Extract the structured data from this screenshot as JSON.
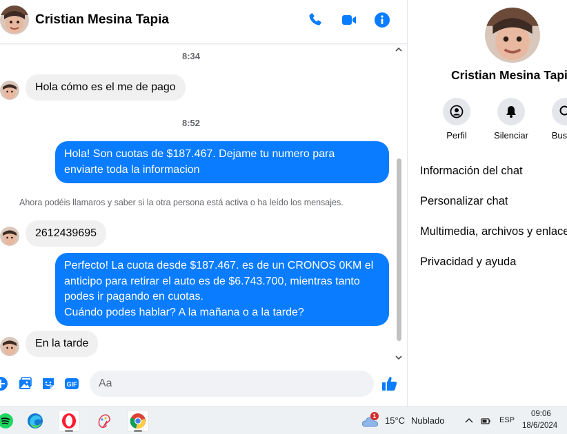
{
  "contact": {
    "name": "Cristian Mesina Tapia"
  },
  "header": {
    "call_icon": "phone-icon",
    "video_icon": "video-camera-icon",
    "info_icon": "info-icon",
    "accent_color": "#0a7cff"
  },
  "messages": [
    {
      "type": "time",
      "text": "8:34"
    },
    {
      "type": "incoming",
      "text": "Hola cómo es el me de pago"
    },
    {
      "type": "time",
      "text": "8:52"
    },
    {
      "type": "outgoing",
      "lines": [
        "Hola! Son cuotas de $187.467. Dejame tu numero para",
        "enviarte toda la informacion"
      ]
    },
    {
      "type": "notice",
      "text": "Ahora podéis llamaros y saber si la otra persona está activa o ha leído los mensajes."
    },
    {
      "type": "incoming",
      "text": "2612439695"
    },
    {
      "type": "outgoing",
      "lines": [
        "Perfecto! La cuota desde $187.467. es de un CRONOS 0KM el",
        "anticipo para retirar el auto es de $6.743.700, mientras tanto",
        "podes ir pagando en cuotas.",
        "Cuándo podes hablar? A la mañana o a la tarde?"
      ]
    },
    {
      "type": "incoming",
      "text": "En la tarde"
    }
  ],
  "composer": {
    "placeholder": "Aa",
    "icons": [
      "plus-circle-icon",
      "image-icon",
      "sticker-icon",
      "gif-icon",
      "emoji-icon",
      "thumbs-up-icon"
    ],
    "gif_label": "GIF"
  },
  "info_panel": {
    "name": "Cristian Mesina Tapia",
    "actions": [
      {
        "label": "Perfil",
        "icon": "profile-icon"
      },
      {
        "label": "Silenciar",
        "icon": "bell-icon"
      },
      {
        "label": "Buscar",
        "icon": "search-icon"
      }
    ],
    "menu": [
      "Información del chat",
      "Personalizar chat",
      "Multimedia, archivos y enlaces",
      "Privacidad y ayuda"
    ]
  },
  "taskbar": {
    "apps": [
      "spotify-icon",
      "edge-icon",
      "opera-icon",
      "paint-icon",
      "chrome-icon"
    ],
    "weather": {
      "badge": "1",
      "temp": "15°C",
      "desc": "Nublado"
    },
    "language": "ESP",
    "time": "09:06",
    "date": "18/6/2024"
  }
}
